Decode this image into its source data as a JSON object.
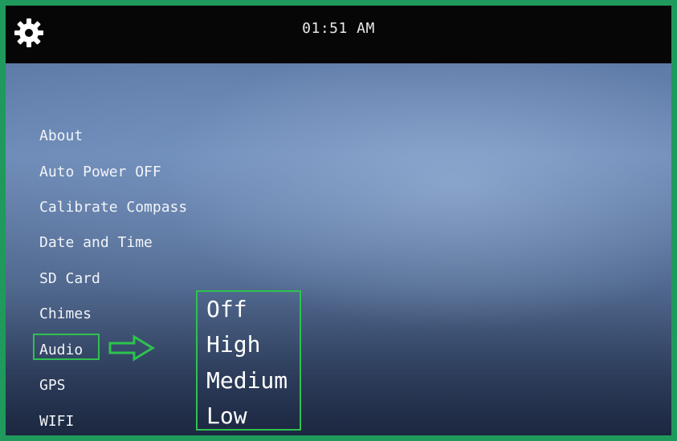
{
  "header": {
    "time": "01:51 AM",
    "settings_icon": "gear-icon"
  },
  "menu": {
    "items": [
      {
        "label": "About"
      },
      {
        "label": "Auto Power OFF"
      },
      {
        "label": "Calibrate Compass"
      },
      {
        "label": "Date and Time"
      },
      {
        "label": "SD Card"
      },
      {
        "label": "Chimes"
      },
      {
        "label": "Audio"
      },
      {
        "label": "GPS"
      },
      {
        "label": "WIFI"
      }
    ],
    "highlighted": "Audio"
  },
  "audio_options": {
    "items": [
      {
        "label": "Off"
      },
      {
        "label": "High"
      },
      {
        "label": "Medium"
      },
      {
        "label": "Low"
      }
    ]
  },
  "colors": {
    "annotation": "#2ec24f",
    "border": "#1f9a5c"
  }
}
